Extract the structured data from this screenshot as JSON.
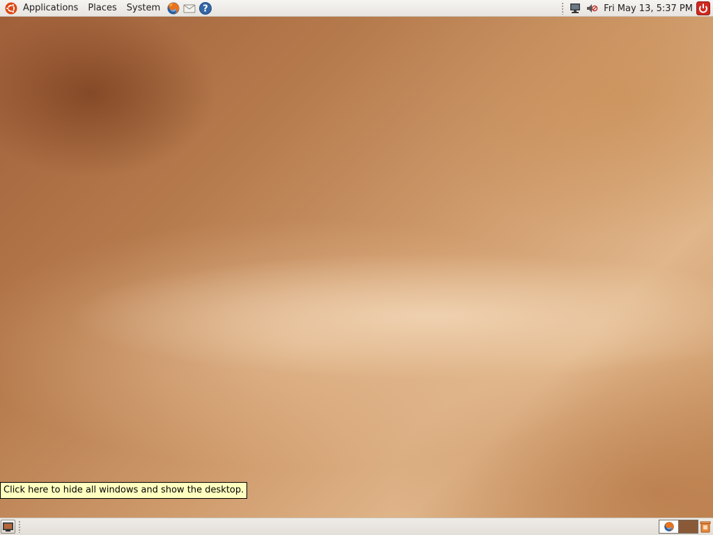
{
  "top_panel": {
    "menus": {
      "applications": "Applications",
      "places": "Places",
      "system": "System"
    },
    "launchers": [
      "firefox-icon",
      "mail-icon",
      "help-icon"
    ],
    "clock": "Fri May 13,  5:37 PM",
    "tray_icons": [
      "network-icon",
      "volume-muted-icon",
      "power-icon"
    ]
  },
  "desktop": {
    "tooltip": "Click here to hide all windows and show the desktop."
  },
  "bottom_panel": {
    "workspaces": [
      "Workspace 1",
      "Workspace 2"
    ],
    "trash_icon": "trash-icon",
    "show_desktop_icon": "show-desktop-icon"
  },
  "colors": {
    "panel": "#ece9e4",
    "tooltip_bg": "#ffffbf",
    "ubuntu_orange": "#dd4814",
    "wallpaper": "#c8905e"
  }
}
